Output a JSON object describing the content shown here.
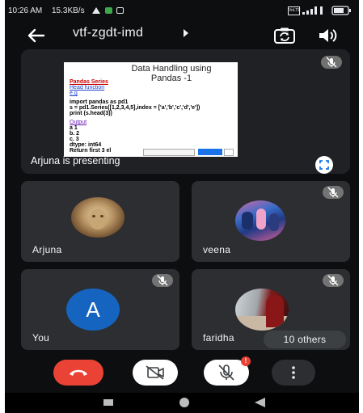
{
  "status_bar": {
    "time": "10:26 AM",
    "speed": "15.3KB/s",
    "network": "Vo LTE"
  },
  "header": {
    "title": "vtf-zgdt-imd",
    "back_icon": "arrow-back-icon",
    "camera_icon": "switch-camera-icon",
    "audio_icon": "speaker-icon"
  },
  "presentation": {
    "slide_title_1": "Data Handling using",
    "slide_title_2": "Pandas -1",
    "slide_line_1": "Pandas Series",
    "slide_line_2": "Head function",
    "slide_line_3": "e.g",
    "code_1": "import pandas as pd1",
    "code_2": "s = pd1.Series([1,2,3,4,5],index = ['a','b','c','d','e'])",
    "code_3": "print (s.head(3))",
    "output_label": "Output",
    "out_1": "a    1",
    "out_2": "b.   2",
    "out_3": "c.   3",
    "out_4": "dtype: int64",
    "out_5": "Return first 3 el",
    "presenter_label": "Arjuna is presenting"
  },
  "participants": [
    {
      "name": "Arjuna",
      "muted": false
    },
    {
      "name": "veena",
      "muted": true
    },
    {
      "name": "You",
      "initial": "A",
      "muted": true
    },
    {
      "name": "faridha",
      "muted": true
    }
  ],
  "others_label": "10 others",
  "controls": {
    "mic_alert_count": "!"
  },
  "colors": {
    "end_call": "#ea4335",
    "avatar_you": "#1565c0",
    "tile_bg": "#2d2e31"
  }
}
